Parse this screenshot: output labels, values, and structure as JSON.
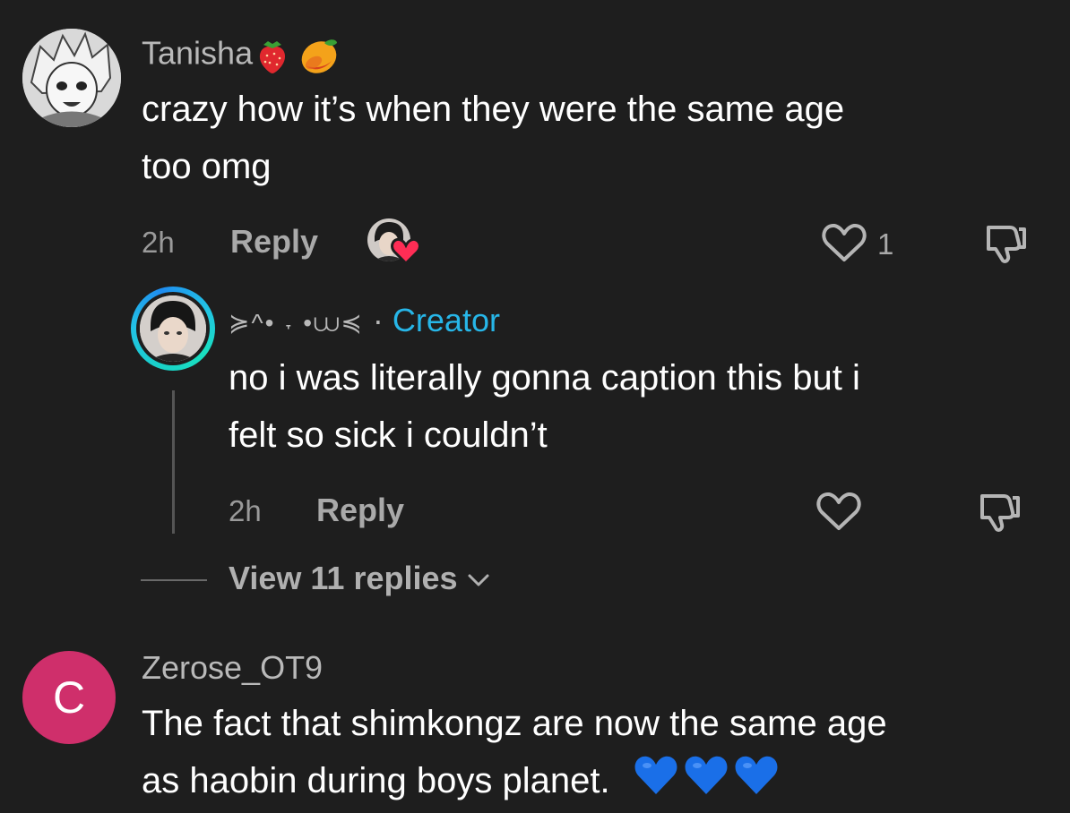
{
  "comments": [
    {
      "username": "Tanisha",
      "text_line1": "crazy how it’s when they were the same age",
      "text_line2": "too omg",
      "time": "2h",
      "reply_label": "Reply",
      "like_count": "1",
      "avatar_icon": "anime-character-avatar",
      "username_emojis": [
        "strawberry-icon",
        "mango-icon"
      ],
      "liked_by_creator": true
    },
    {
      "username": "≽^• ˕ •⩊≼",
      "separator": "·",
      "creator_label": "Creator",
      "text_line1": "no i was literally gonna caption this but i",
      "text_line2": "felt so sick i couldn’t",
      "time": "2h",
      "reply_label": "Reply",
      "avatar_icon": "person-photo-avatar"
    }
  ],
  "view_replies": "View 11 replies",
  "comment2": {
    "avatar_letter": "C",
    "username": "Zerose_OT9",
    "text_line1": "The fact that shimkongz are now the same age",
    "text_line2": "as haobin during boys planet.",
    "emojis": [
      "blue-heart-icon",
      "blue-heart-icon",
      "blue-heart-icon"
    ]
  },
  "colors": {
    "background": "#1e1e1e",
    "creator_accent": "#27b6e8",
    "avatar_c_bg": "#cf2f6b",
    "heart_red": "#ff2d55",
    "blue_heart": "#1a6fe8"
  }
}
